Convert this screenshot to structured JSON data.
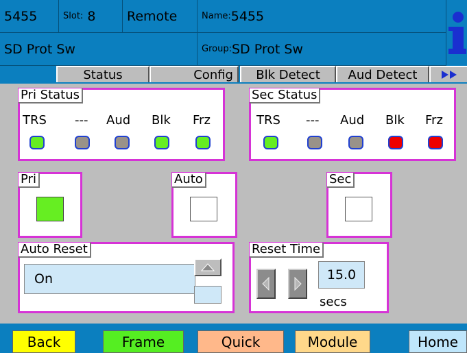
{
  "header": {
    "id": "5455",
    "slot_label": "Slot:",
    "slot_value": "8",
    "mode": "Remote",
    "name_label": "Name:",
    "name_value": "5455",
    "device": "SD Prot Sw",
    "group_label": "Group:",
    "group_value": "SD Prot Sw",
    "info_icon": "info-icon"
  },
  "tabs": [
    {
      "label": "Status"
    },
    {
      "label": "Config"
    },
    {
      "label": "Blk Detect"
    },
    {
      "label": "Aud Detect"
    }
  ],
  "more_icon": "double-triangle-right-icon",
  "pri_status": {
    "title": "Pri Status",
    "labels": [
      "TRS",
      "---",
      "Aud",
      "Blk",
      "Frz"
    ],
    "leds": [
      "green",
      "gray",
      "gray",
      "green",
      "green"
    ]
  },
  "sec_status": {
    "title": "Sec Status",
    "labels": [
      "TRS",
      "---",
      "Aud",
      "Blk",
      "Frz"
    ],
    "leds": [
      "green",
      "gray",
      "gray",
      "red",
      "red"
    ]
  },
  "pri": {
    "title": "Pri",
    "active": true
  },
  "auto": {
    "title": "Auto",
    "active": false
  },
  "sec": {
    "title": "Sec",
    "active": false
  },
  "auto_reset": {
    "title": "Auto Reset",
    "value": "On"
  },
  "reset_time": {
    "title": "Reset Time",
    "value": "15.0",
    "unit": "secs"
  },
  "nav": {
    "back": "Back",
    "frame": "Frame",
    "quick": "Quick",
    "module": "Module",
    "home": "Home"
  },
  "colors": {
    "header_blue": "#0b7fbf",
    "panel_border": "#d633d6",
    "led_green": "#66ee22",
    "led_red": "#ee0000",
    "led_gray": "#999289"
  }
}
